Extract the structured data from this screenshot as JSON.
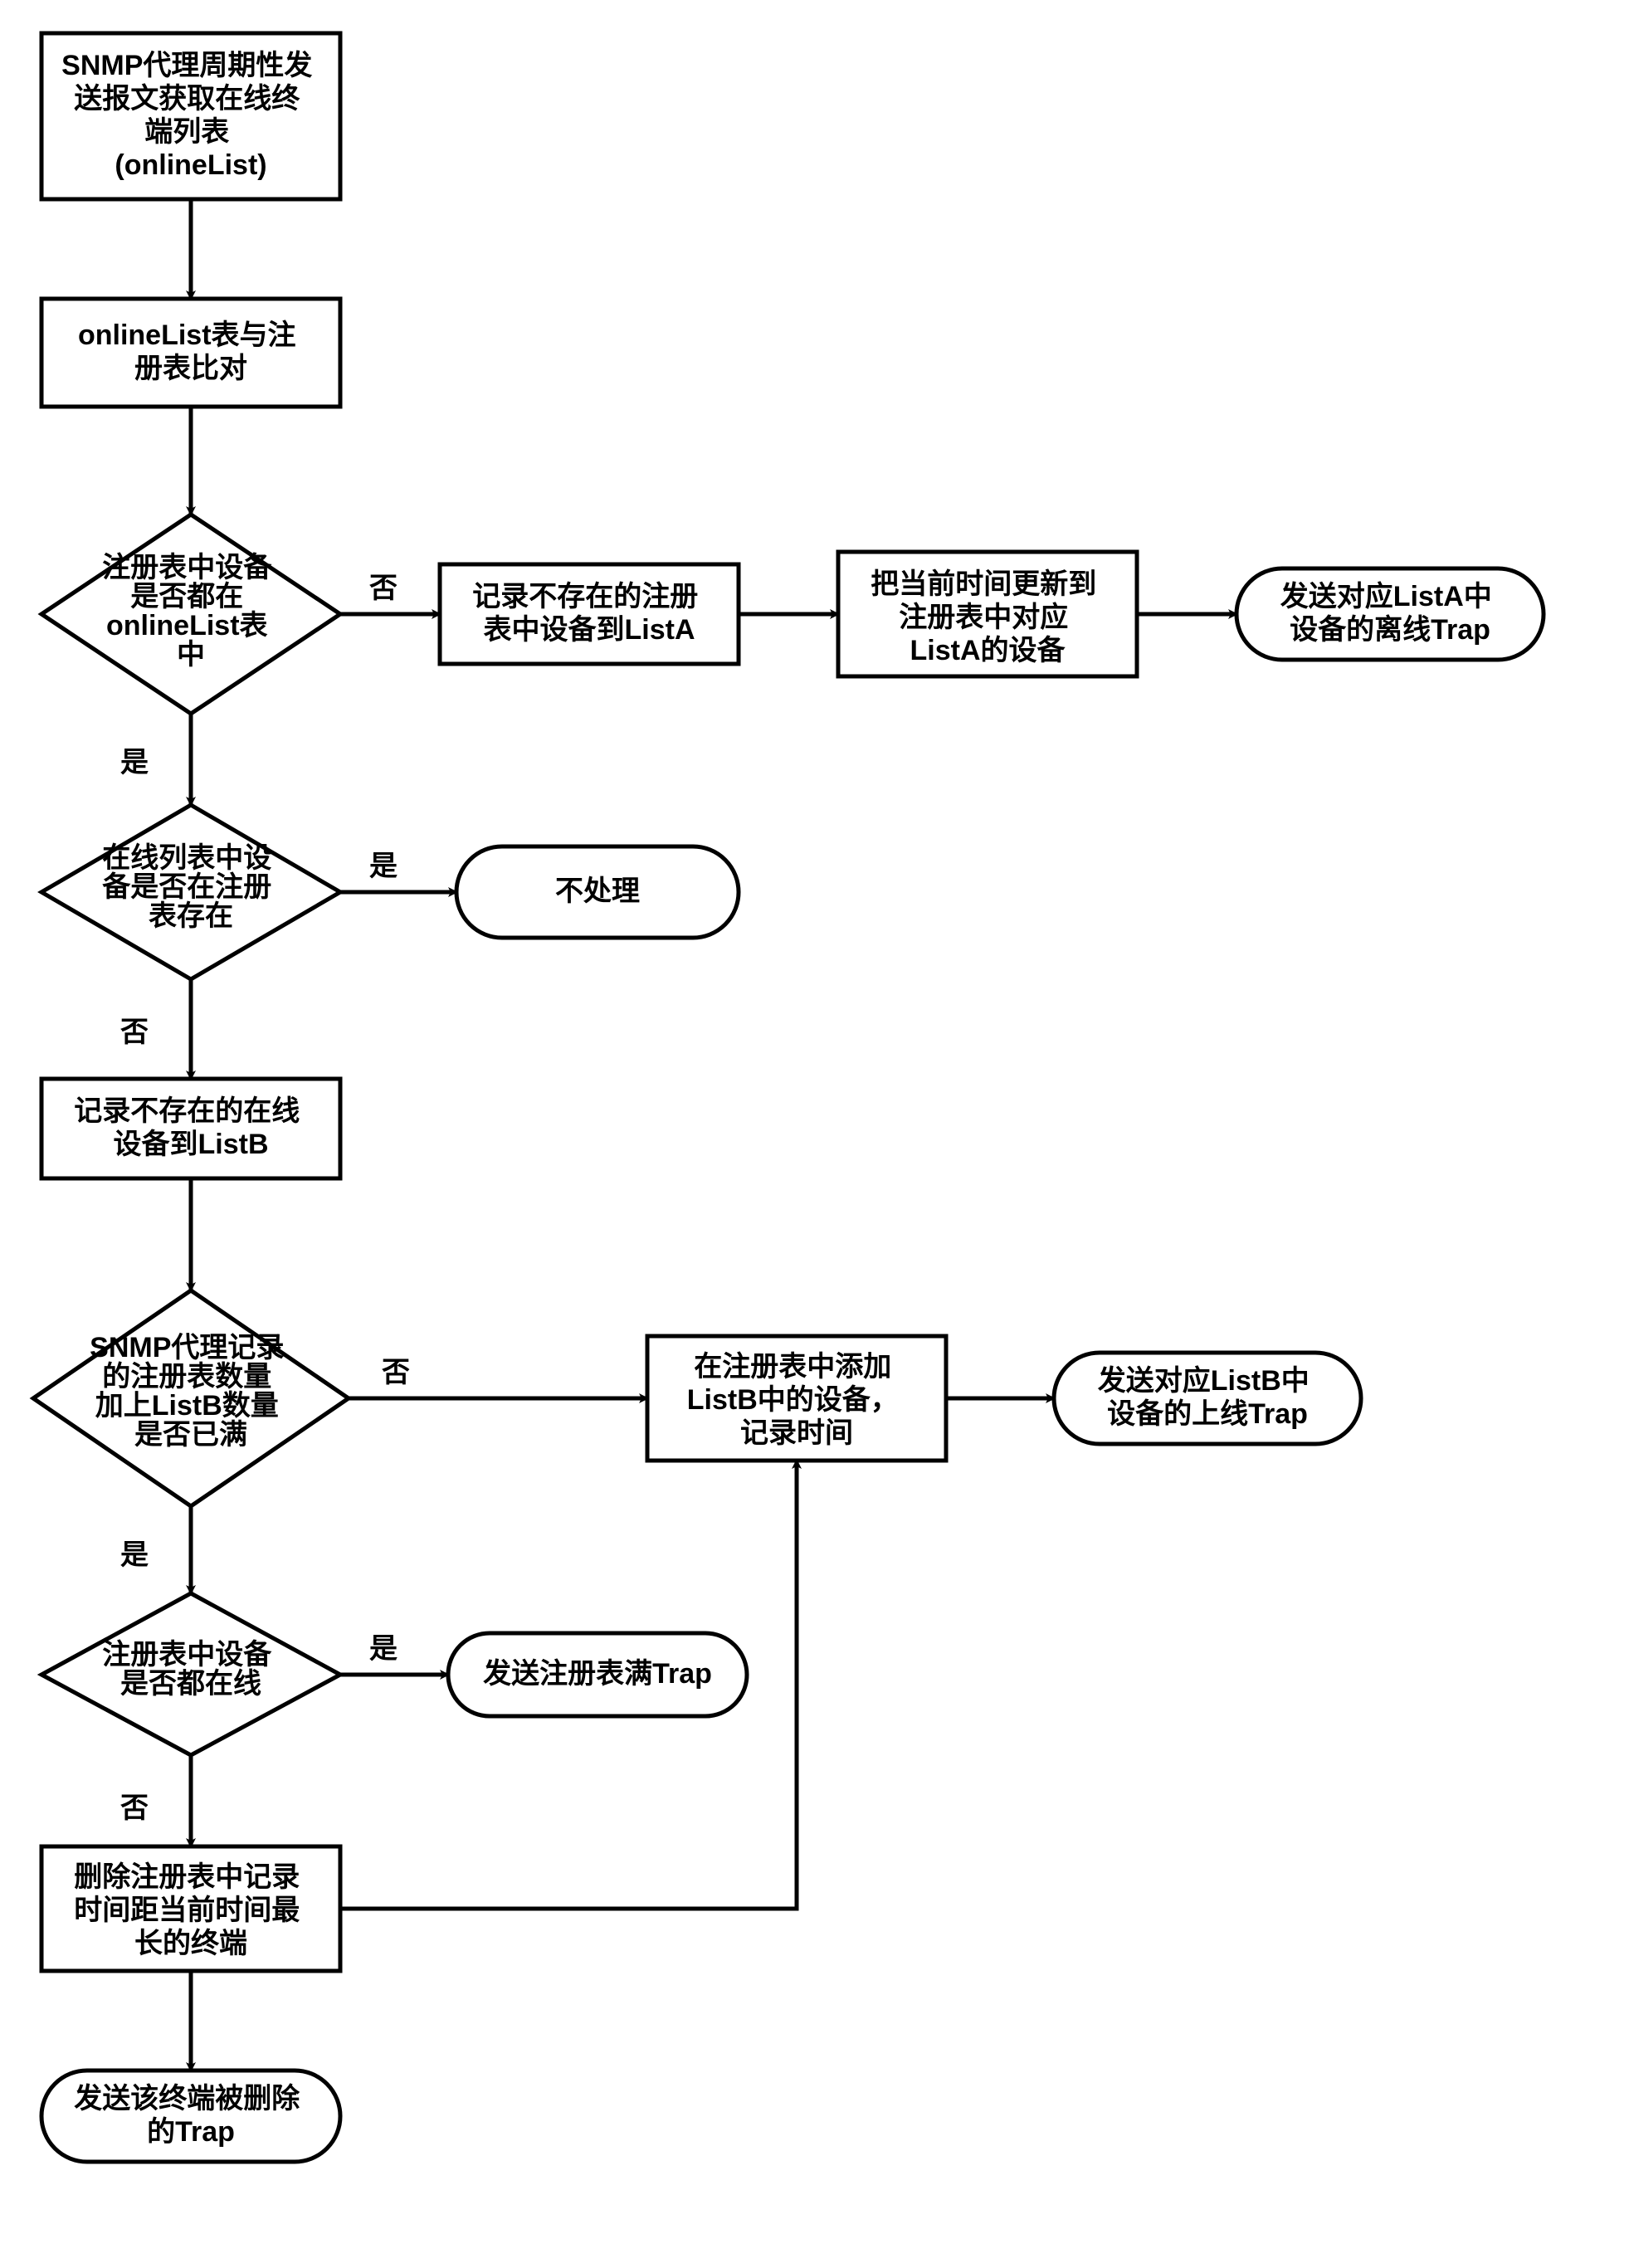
{
  "nodes": {
    "n1": "SNMP代理周期性发\n送报文获取在线终\n端列表\n(onlineList)",
    "n2": "onlineList表与注\n册表比对",
    "d1": "注册表中设备\n是否都在\nonlineList表\n中",
    "n3": "记录不存在的注册\n表中设备到ListA",
    "n4": "把当前时间更新到\n注册表中对应\nListA的设备",
    "t1": "发送对应ListA中\n设备的离线Trap",
    "d2": "在线列表中设\n备是否在注册\n表存在",
    "t2": "不处理",
    "n5": "记录不存在的在线\n设备到ListB",
    "d3": "SNMP代理记录\n的注册表数量\n加上ListB数量\n是否已满",
    "n6": "在注册表中添加\nListB中的设备，\n记录时间",
    "t3": "发送对应ListB中\n设备的上线Trap",
    "d4": "注册表中设备\n是否都在线",
    "t4": "发送注册表满Trap",
    "n7": "删除注册表中记录\n时间距当前时间最\n长的终端",
    "t5": "发送该终端被删除\n的Trap"
  },
  "labels": {
    "yes": "是",
    "no": "否"
  }
}
